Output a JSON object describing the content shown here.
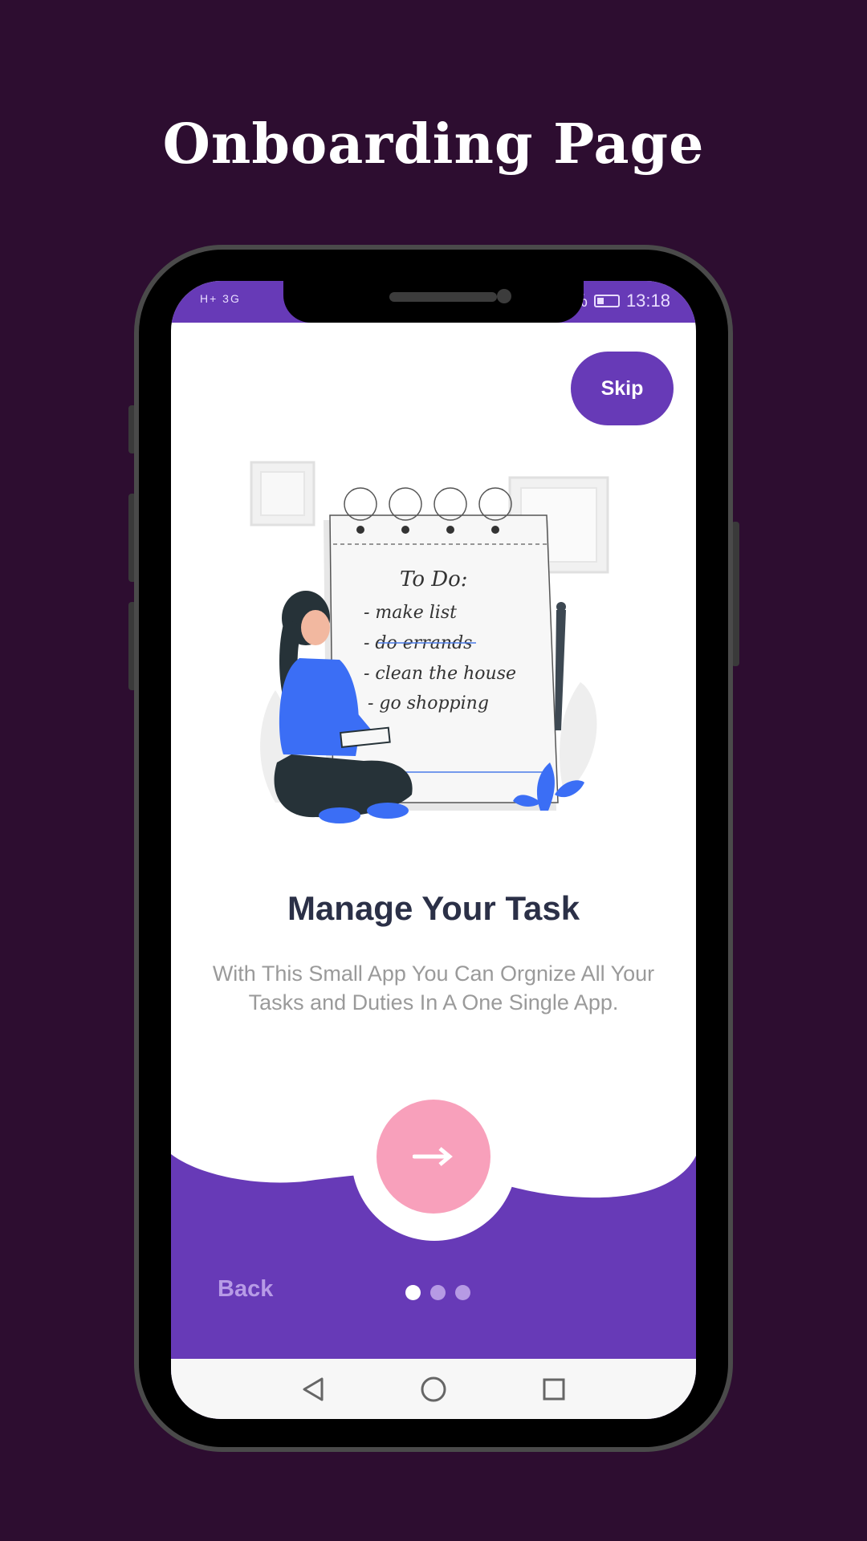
{
  "page": {
    "title": "Onboarding Page"
  },
  "status_bar": {
    "left_text": "H+ 3G ",
    "battery_percent_text": "%",
    "time": "13:18"
  },
  "onboarding": {
    "skip_label": "Skip",
    "headline": "Manage Your Task",
    "description": "With This Small App You Can Orgnize All Your Tasks and Duties In A One Single App.",
    "illustration": {
      "note_title": "To Do:",
      "items": [
        "- make list",
        "- do errands",
        "- clean the house",
        "- go shopping",
        "- ..."
      ]
    },
    "next_icon": "arrow-right-icon",
    "back_label": "Back",
    "page_indicator": {
      "count": 3,
      "active_index": 0
    }
  },
  "colors": {
    "background": "#2d0d30",
    "accent": "#673ab7",
    "next_button": "#f8a0bb",
    "headline": "#2b3047"
  },
  "nav_bar": {
    "icons": [
      "back-triangle-icon",
      "home-circle-icon",
      "recents-square-icon"
    ]
  }
}
